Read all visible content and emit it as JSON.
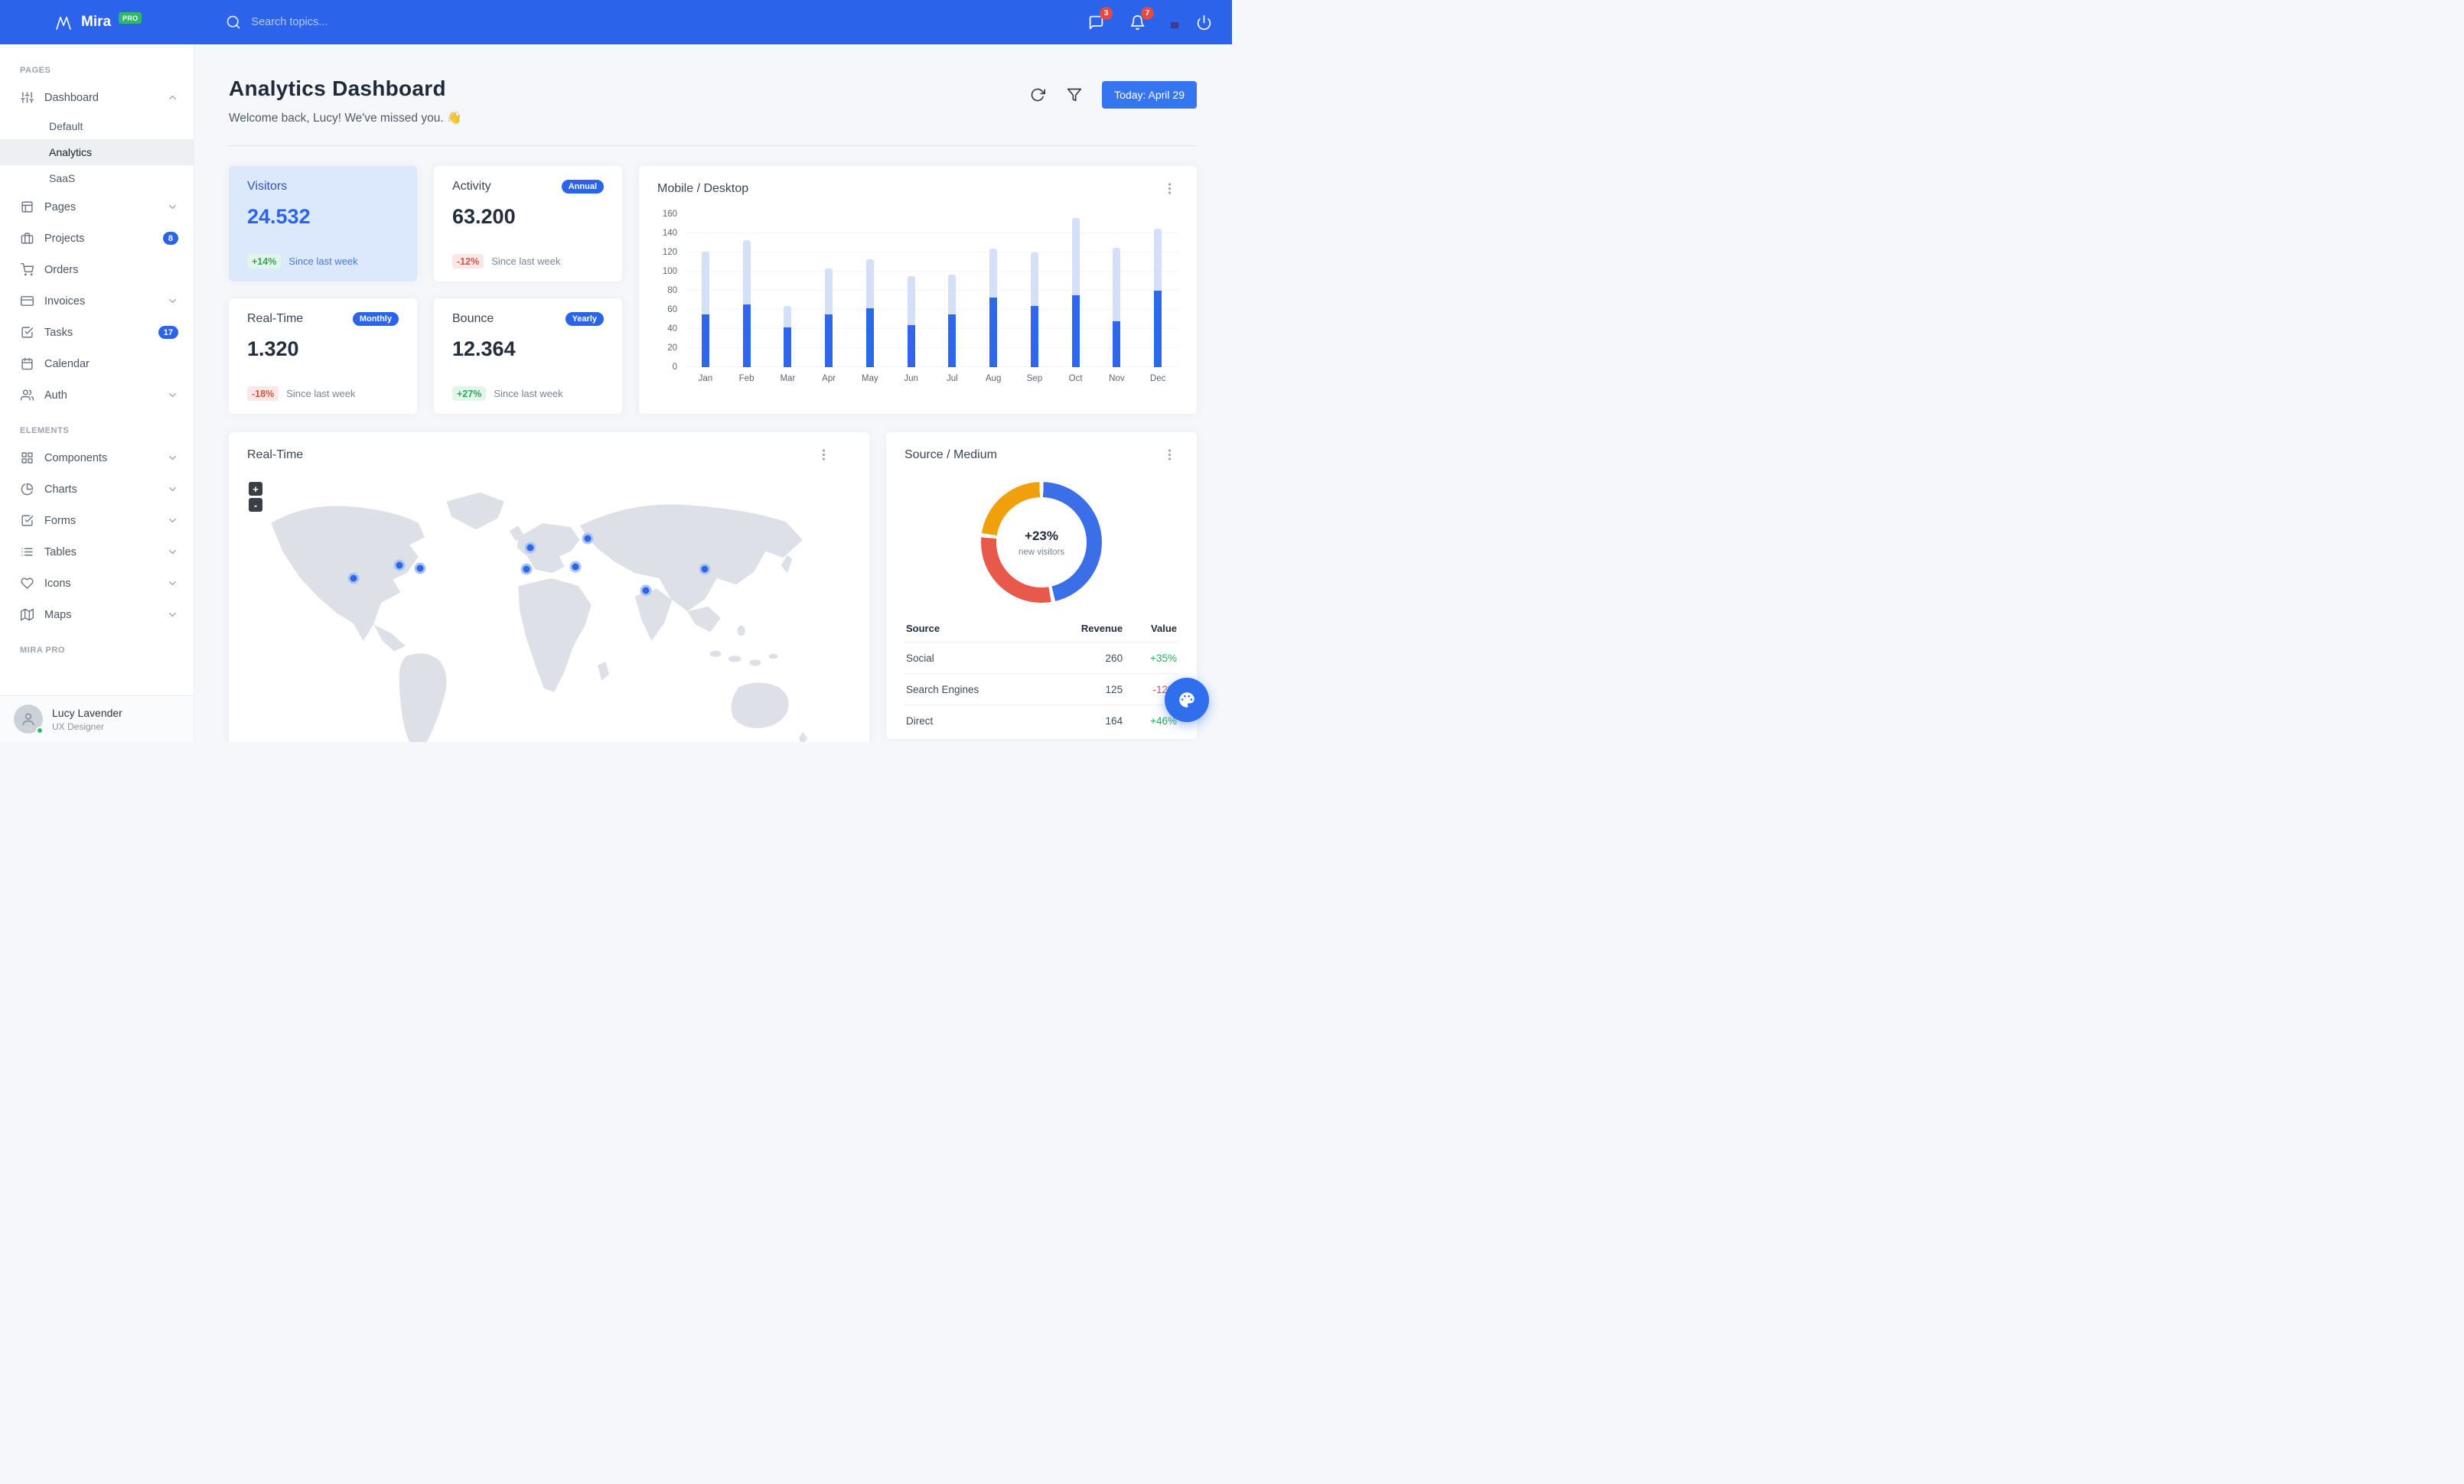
{
  "navbar": {
    "brand": "Mira",
    "brand_badge": "PRO",
    "search_placeholder": "Search topics...",
    "messages_count": "3",
    "notifications_count": "7"
  },
  "sidebar": {
    "sections": [
      {
        "title": "PAGES",
        "items": [
          {
            "label": "Dashboard",
            "icon": "sliders-icon",
            "chevron": "up",
            "children": [
              {
                "label": "Default"
              },
              {
                "label": "Analytics",
                "active": true
              },
              {
                "label": "SaaS"
              }
            ]
          },
          {
            "label": "Pages",
            "icon": "layout-icon",
            "chevron": "down"
          },
          {
            "label": "Projects",
            "icon": "briefcase-icon",
            "badge": "8"
          },
          {
            "label": "Orders",
            "icon": "shopping-cart-icon"
          },
          {
            "label": "Invoices",
            "icon": "credit-card-icon",
            "chevron": "down"
          },
          {
            "label": "Tasks",
            "icon": "check-square-icon",
            "badge": "17"
          },
          {
            "label": "Calendar",
            "icon": "calendar-icon"
          },
          {
            "label": "Auth",
            "icon": "users-icon",
            "chevron": "down"
          }
        ]
      },
      {
        "title": "ELEMENTS",
        "items": [
          {
            "label": "Components",
            "icon": "grid-icon",
            "chevron": "down"
          },
          {
            "label": "Charts",
            "icon": "pie-chart-icon",
            "chevron": "down"
          },
          {
            "label": "Forms",
            "icon": "check-square-icon",
            "chevron": "down"
          },
          {
            "label": "Tables",
            "icon": "list-icon",
            "chevron": "down"
          },
          {
            "label": "Icons",
            "icon": "heart-icon",
            "chevron": "down"
          },
          {
            "label": "Maps",
            "icon": "map-icon",
            "chevron": "down"
          }
        ]
      },
      {
        "title": "MIRA PRO",
        "items": []
      }
    ],
    "user": {
      "name": "Lucy Lavender",
      "role": "UX Designer"
    }
  },
  "header": {
    "title": "Analytics Dashboard",
    "subtitle": "Welcome back, Lucy! We've missed you. 👋",
    "date_button": "Today: April 29"
  },
  "stats": [
    {
      "title": "Visitors",
      "value": "24.532",
      "delta": "+14%",
      "delta_dir": "up",
      "caption": "Since last week"
    },
    {
      "title": "Activity",
      "badge": "Annual",
      "value": "63.200",
      "delta": "-12%",
      "delta_dir": "down",
      "caption": "Since last week"
    },
    {
      "title": "Real-Time",
      "badge": "Monthly",
      "value": "1.320",
      "delta": "-18%",
      "delta_dir": "down",
      "caption": "Since last week"
    },
    {
      "title": "Bounce",
      "badge": "Yearly",
      "value": "12.364",
      "delta": "+27%",
      "delta_dir": "up",
      "caption": "Since last week"
    }
  ],
  "chart_data": [
    {
      "type": "bar",
      "title": "Mobile / Desktop",
      "stacked": true,
      "categories": [
        "Jan",
        "Feb",
        "Mar",
        "Apr",
        "May",
        "Jun",
        "Jul",
        "Aug",
        "Sep",
        "Oct",
        "Nov",
        "Dec"
      ],
      "series": [
        {
          "name": "Mobile",
          "color": "#2f67ec",
          "values": [
            55,
            66,
            42,
            55,
            62,
            44,
            55,
            73,
            64,
            75,
            48,
            80
          ]
        },
        {
          "name": "Desktop",
          "color": "#d4e0f8",
          "values": [
            66,
            67,
            22,
            48,
            51,
            51,
            42,
            51,
            56,
            81,
            77,
            65
          ]
        }
      ],
      "ylim": [
        0,
        160
      ],
      "yticks": [
        0,
        20,
        40,
        60,
        80,
        100,
        120,
        140,
        160
      ],
      "grid": false,
      "legend": "none"
    },
    {
      "type": "pie",
      "title": "Source / Medium",
      "center_label": "+23%",
      "center_sublabel": "new visitors",
      "slices": [
        {
          "label": "Social",
          "value": 260,
          "color": "#3a6fe8"
        },
        {
          "label": "Direct",
          "value": 164,
          "color": "#e8584b"
        },
        {
          "label": "Search Engines",
          "value": 125,
          "color": "#efa00b"
        }
      ]
    }
  ],
  "realtime_map": {
    "title": "Real-Time",
    "zoom_in": "+",
    "zoom_out": "-",
    "markers": [
      {
        "x": 19.5,
        "y": 30.5
      },
      {
        "x": 26.7,
        "y": 26.5
      },
      {
        "x": 29.9,
        "y": 27.4
      },
      {
        "x": 47.1,
        "y": 21.4
      },
      {
        "x": 46.5,
        "y": 27.7
      },
      {
        "x": 56.0,
        "y": 18.6
      },
      {
        "x": 54.1,
        "y": 27.0
      },
      {
        "x": 65.1,
        "y": 34.2
      },
      {
        "x": 74.3,
        "y": 27.7
      }
    ]
  },
  "source_medium": {
    "columns": [
      "Source",
      "Revenue",
      "Value"
    ],
    "rows": [
      {
        "source": "Social",
        "revenue": "260",
        "value": "+35%",
        "dir": "up"
      },
      {
        "source": "Search Engines",
        "revenue": "125",
        "value": "-12%",
        "dir": "down"
      },
      {
        "source": "Direct",
        "revenue": "164",
        "value": "+46%",
        "dir": "up"
      }
    ]
  }
}
